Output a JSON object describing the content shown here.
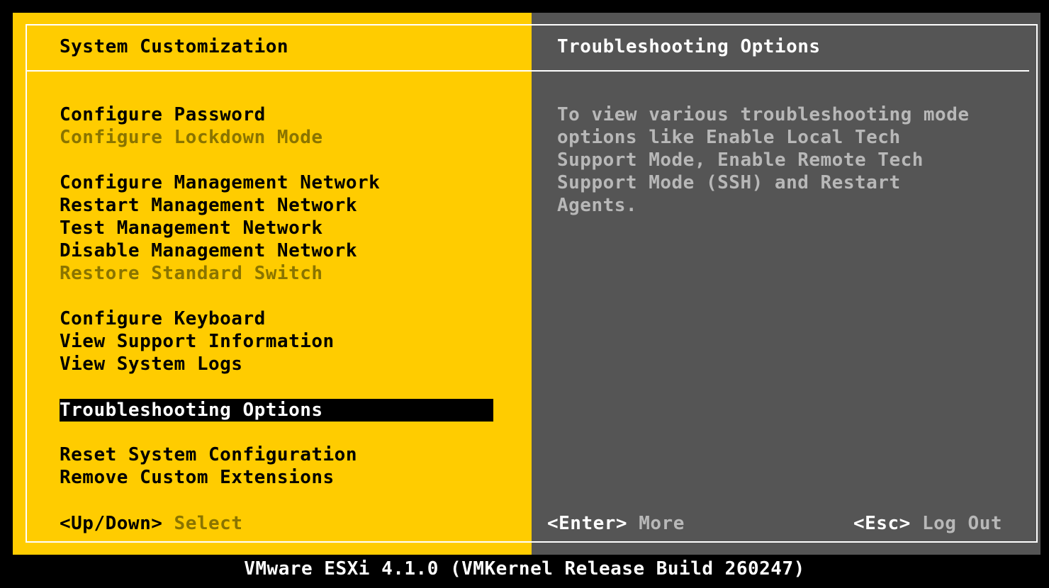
{
  "left_panel": {
    "title": "System Customization",
    "menu": [
      {
        "label": "Configure Password",
        "enabled": true
      },
      {
        "label": "Configure Lockdown Mode",
        "enabled": false
      },
      {
        "label": "Configure Management Network",
        "enabled": true
      },
      {
        "label": "Restart Management Network",
        "enabled": true
      },
      {
        "label": "Test Management Network",
        "enabled": true
      },
      {
        "label": "Disable Management Network",
        "enabled": true
      },
      {
        "label": "Restore Standard Switch",
        "enabled": false
      },
      {
        "label": "Configure Keyboard",
        "enabled": true
      },
      {
        "label": "View Support Information",
        "enabled": true
      },
      {
        "label": "View System Logs",
        "enabled": true
      },
      {
        "label": "Troubleshooting Options",
        "enabled": true,
        "selected": true
      },
      {
        "label": "Reset System Configuration",
        "enabled": true
      },
      {
        "label": "Remove Custom Extensions",
        "enabled": true
      }
    ],
    "hint_key": "<Up/Down>",
    "hint_action": "Select"
  },
  "right_panel": {
    "title": "Troubleshooting Options",
    "description": "To view various troubleshooting mode\noptions like Enable Local Tech\nSupport Mode, Enable Remote Tech\nSupport Mode (SSH) and Restart\nAgents.",
    "enter_key": "<Enter>",
    "enter_action": "More",
    "esc_key": "<Esc>",
    "esc_action": "Log Out"
  },
  "footer": "VMware ESXi 4.1.0 (VMKernel Release Build 260247)",
  "colors": {
    "left_bg": "#ffcc00",
    "right_bg": "#555555",
    "selected_bg": "#000000",
    "disabled_text": "#8a7400"
  }
}
